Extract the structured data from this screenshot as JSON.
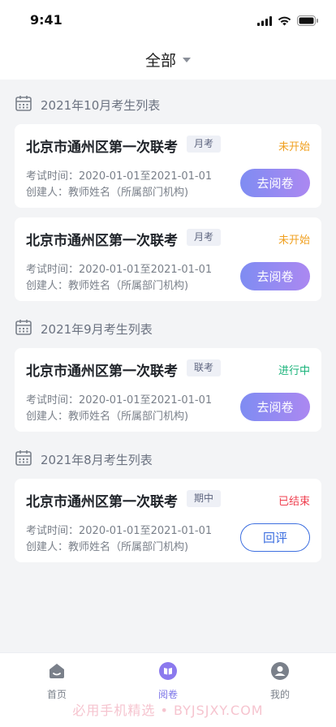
{
  "status_bar": {
    "time": "9:41"
  },
  "header": {
    "title": "全部"
  },
  "groups": [
    {
      "title": "2021年10月考生列表",
      "cards": [
        {
          "title": "北京市通州区第一次联考",
          "tag": "月考",
          "status": "未开始",
          "status_color": "#f0a020",
          "time_label": "考试时间：",
          "time_value": "2020-01-01至2021-01-01",
          "creator_label": "创建人：",
          "creator_value": "教师姓名（所属部门机构)",
          "button": "去阅卷"
        },
        {
          "title": "北京市通州区第一次联考",
          "tag": "月考",
          "status": "未开始",
          "status_color": "#f0a020",
          "time_label": "考试时间：",
          "time_value": "2020-01-01至2021-01-01",
          "creator_label": "创建人：",
          "creator_value": "教师姓名（所属部门机构)",
          "button": "去阅卷"
        }
      ]
    },
    {
      "title": "2021年9月考生列表",
      "cards": [
        {
          "title": "北京市通州区第一次联考",
          "tag": "联考",
          "status": "进行中",
          "status_color": "#19b37a",
          "time_label": "考试时间：",
          "time_value": "2020-01-01至2021-01-01",
          "creator_label": "创建人：",
          "creator_value": "教师姓名（所属部门机构)",
          "button": "去阅卷"
        }
      ]
    },
    {
      "title": "2021年8月考生列表",
      "cards": [
        {
          "title": "北京市通州区第一次联考",
          "tag": "期中",
          "status": "已结束",
          "status_color": "#ef3f4f",
          "time_label": "考试时间：",
          "time_value": "2020-01-01至2021-01-01",
          "creator_label": "创建人：",
          "creator_value": "教师姓名（所属部门机构)",
          "button": "回评"
        }
      ]
    }
  ],
  "tabbar": {
    "items": [
      {
        "label": "首页",
        "icon": "home-icon"
      },
      {
        "label": "阅卷",
        "icon": "grading-book-icon",
        "active": true
      },
      {
        "label": "我的",
        "icon": "profile-icon"
      }
    ]
  },
  "watermark": "必用手机精选 • BYJSJXY.COM"
}
